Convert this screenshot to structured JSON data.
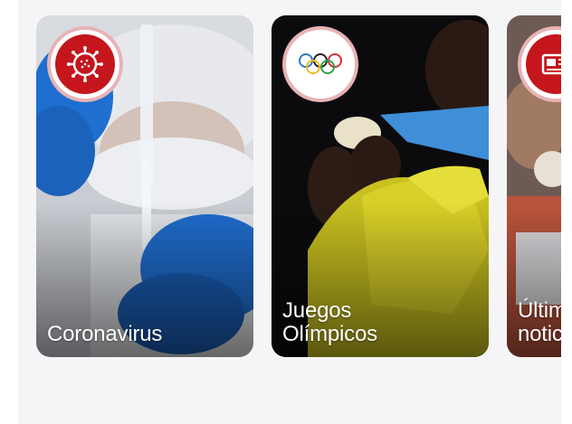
{
  "cards": [
    {
      "label": "Coronavirus",
      "icon": "virus-icon",
      "accent": "#c4161c"
    },
    {
      "label": "Juegos\nOlímpicos",
      "icon": "olympic-rings-icon",
      "accent": "#c4161c"
    },
    {
      "label": "Últimas\nnoticias",
      "icon": "news-icon",
      "accent": "#c4161c"
    }
  ],
  "colors": {
    "accent": "#c4161c",
    "badge_ring": "#e8b3b5",
    "background": "#f5f5f7"
  }
}
